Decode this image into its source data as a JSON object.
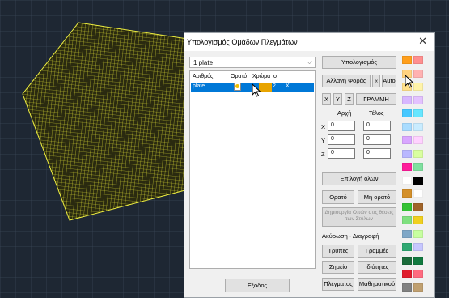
{
  "dialog": {
    "title": "Υπολογισμός Ομάδων Πλεγμάτων",
    "close_glyph": "✕",
    "combo_value": "1 plate",
    "combo_arrow": "⌵"
  },
  "list": {
    "headers": [
      "Αριθμός",
      "Ορατό",
      "Χρώμα",
      "σ"
    ],
    "row": {
      "name": "plate",
      "index": "2",
      "flag": "X"
    }
  },
  "buttons": {
    "calculate": "Υπολογισμός",
    "change_direction": "Αλλαγή Φοράς",
    "arrow_left": "«",
    "auto": "Auto",
    "x": "X",
    "y": "Y",
    "z": "Z",
    "line": "ΓΡΑΜΜΗ",
    "select_all": "Επιλογή όλων",
    "visible": "Ορατό",
    "not_visible": "Μη ορατό",
    "create_holes": "Δημιουργία Οπών στις θέσεις των Στύλων",
    "holes": "Τρύπες",
    "lines": "Γραμμές",
    "point": "Σημείο",
    "properties": "Ιδιότητες",
    "mesh": "Πλέγματος",
    "math": "Μαθηματικού",
    "exit": "Εξοδος"
  },
  "coords": {
    "start_label": "Αρχή",
    "end_label": "Τέλος",
    "axis_x": "X",
    "axis_y": "Y",
    "axis_z": "Z",
    "start": [
      "0",
      "0",
      "0"
    ],
    "end": [
      "0",
      "0",
      "0"
    ]
  },
  "section_label": "Ακύρωση - Διαγραφή",
  "palette": {
    "left": [
      "#ff9f1c",
      "#ffd27f",
      "#ffe08a",
      "#d7b7ff",
      "#47c8ff",
      "#a9dcff",
      "#d9a6ff",
      "#b9b7ff",
      "#ff1c9b",
      "#ffffff",
      "#d4902a",
      "#33c233",
      "#7fe07f",
      "#7fa7c7",
      "#2fa872",
      "#1a6b3a",
      "#e01c2c",
      "#808080"
    ],
    "right": [
      "#ff8f8f",
      "#ffb1b1",
      "#fff3a8",
      "#e3c2ff",
      "#67e6ff",
      "#c9ecff",
      "#ffd2ff",
      "#d9ff9f",
      "#7fe09f",
      "#000000",
      "#ffffff",
      "#a0642a",
      "#f0d020",
      "#c7ffa0",
      "#c7c7ff",
      "#117a3f",
      "#ff6b7f",
      "#c0a070"
    ]
  },
  "colors": {
    "selection": "#0078d7",
    "mesh": "#e6e635",
    "cad_background": "#1e2733"
  }
}
